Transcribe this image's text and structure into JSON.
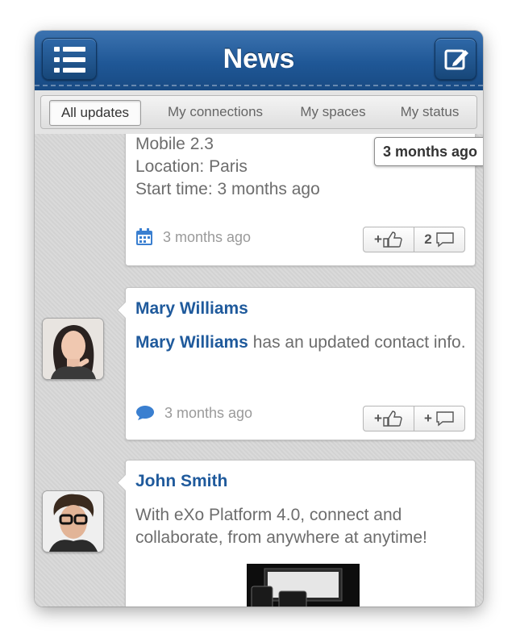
{
  "header": {
    "title": "News"
  },
  "segments": [
    {
      "label": "All updates",
      "active": true
    },
    {
      "label": "My connections",
      "active": false
    },
    {
      "label": "My spaces",
      "active": false
    },
    {
      "label": "My status",
      "active": false
    }
  ],
  "floating_time": "3 months ago",
  "posts": [
    {
      "lines": [
        "Mobile 2.3",
        "Location: Paris",
        "Start time: 3 months ago"
      ],
      "meta_icon": "calendar-icon",
      "time": "3 months ago",
      "like_label": "+",
      "comment_label": "2"
    },
    {
      "author": "Mary Williams",
      "body_author": "Mary Williams",
      "body_text": " has an updated contact info.",
      "meta_icon": "comment-bubble-icon",
      "time": "3 months ago",
      "like_label": "+",
      "comment_label": "+"
    },
    {
      "author": "John Smith",
      "body_text": "With eXo Platform 4.0, connect and collaborate, from anywhere at anytime!"
    }
  ],
  "colors": {
    "nav_blue": "#1f5796",
    "link_blue": "#1f5a9c",
    "muted_text": "#6d6d6d"
  }
}
